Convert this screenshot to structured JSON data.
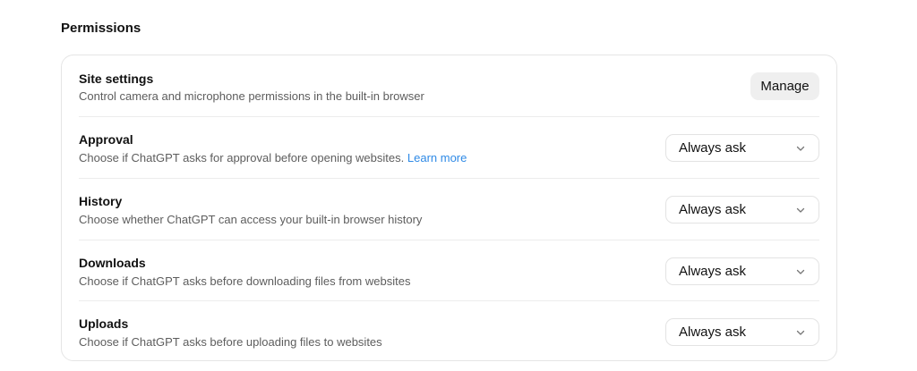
{
  "section": {
    "title": "Permissions"
  },
  "rows": [
    {
      "title": "Site settings",
      "description": "Control camera and microphone permissions in the built-in browser",
      "control": "button",
      "button_label": "Manage"
    },
    {
      "title": "Approval",
      "description": "Choose if ChatGPT asks for approval before opening websites.",
      "link_label": "Learn more",
      "control": "select",
      "value": "Always ask",
      "icon": "chevron-down-icon"
    },
    {
      "title": "History",
      "description": "Choose whether ChatGPT can access your built-in browser history",
      "control": "select",
      "value": "Always ask",
      "icon": "chevron-down-icon"
    },
    {
      "title": "Downloads",
      "description": "Choose if ChatGPT asks before downloading files from websites",
      "control": "select",
      "value": "Always ask",
      "icon": "chevron-down-icon"
    },
    {
      "title": "Uploads",
      "description": "Choose if ChatGPT asks before uploading files to websites",
      "control": "select",
      "value": "Always ask",
      "icon": "chevron-down-icon"
    }
  ],
  "colors": {
    "link": "#2f8ae6",
    "description_text": "#5d5d5d",
    "manage_button_bg": "#efefef",
    "border": "#e5e5e5"
  }
}
